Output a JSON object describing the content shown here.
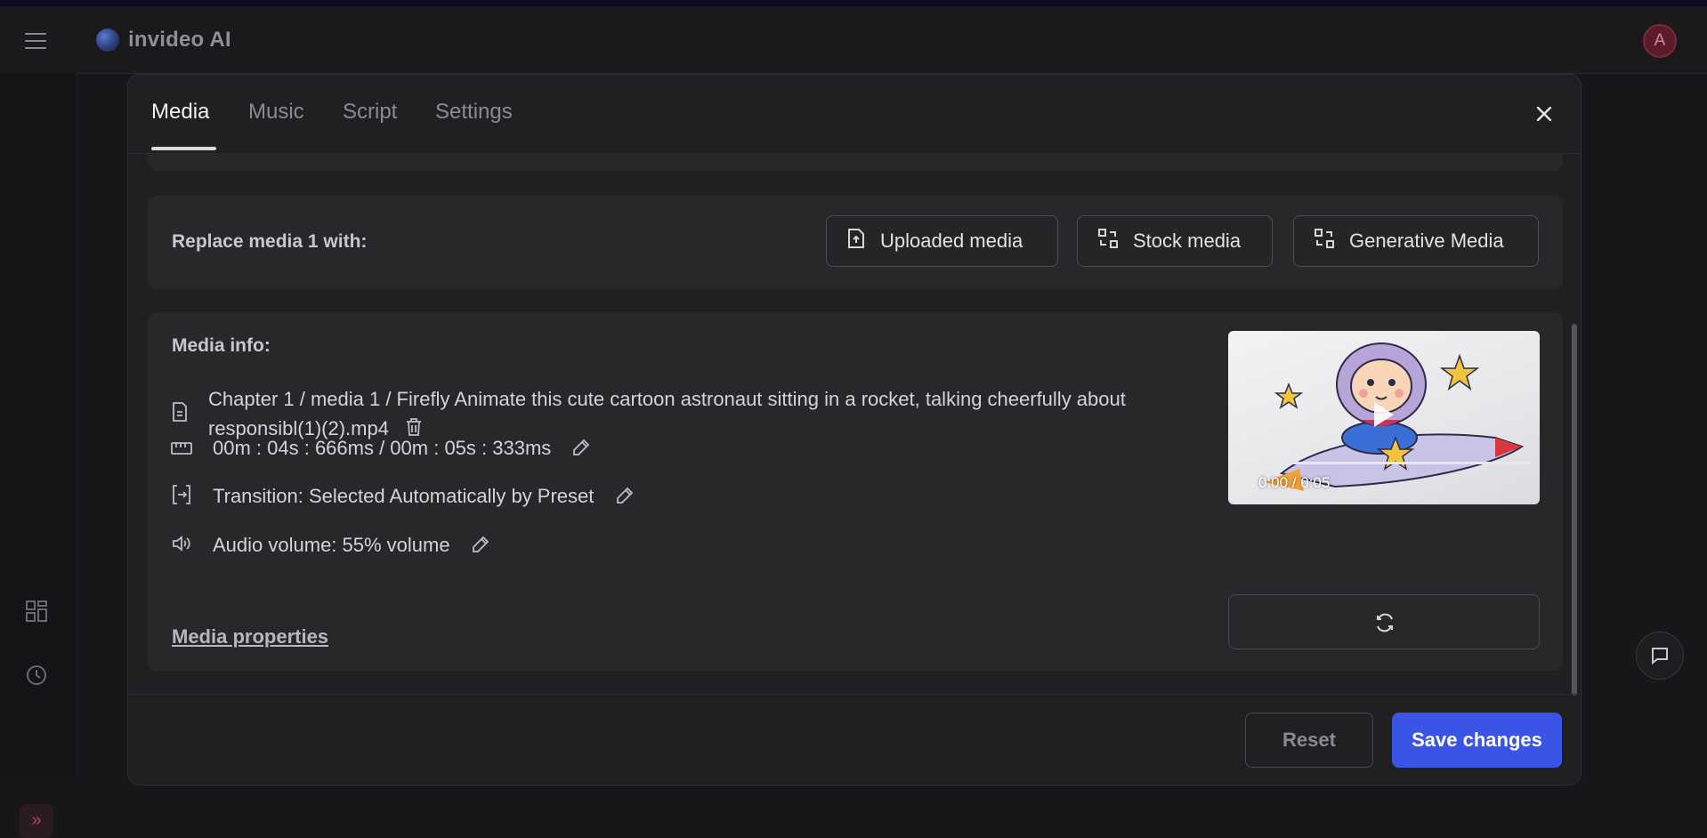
{
  "app": {
    "name": "invideo AI",
    "avatar_initial": "A"
  },
  "tabs": [
    {
      "label": "Media",
      "active": true
    },
    {
      "label": "Music",
      "active": false
    },
    {
      "label": "Script",
      "active": false
    },
    {
      "label": "Settings",
      "active": false
    }
  ],
  "replace": {
    "label": "Replace media 1 with:",
    "buttons": [
      "Uploaded media",
      "Stock media",
      "Generative Media"
    ]
  },
  "media_info": {
    "title": "Media info:",
    "file_line1": "Chapter 1 / media 1 / Firefly Animate this cute cartoon astronaut sitting in a rocket, talking cheerfully about",
    "file_line2": "responsibl(1)(2).mp4",
    "duration": "00m : 04s : 666ms / 00m : 05s : 333ms",
    "transition": "Transition: Selected Automatically by Preset",
    "volume": "Audio volume: 55% volume",
    "properties_link": "Media properties"
  },
  "video": {
    "time": "0:00 / 0:05"
  },
  "footer": {
    "reset": "Reset",
    "save": "Save changes"
  },
  "icons": [
    "menu-icon",
    "grid-icon",
    "history-icon",
    "chevrons-right-icon",
    "close-icon",
    "upload-file-icon",
    "swap-icon",
    "document-icon",
    "trash-icon",
    "ruler-icon",
    "transition-icon",
    "volume-icon",
    "pencil-icon",
    "refresh-icon",
    "chat-icon",
    "play-icon"
  ],
  "colors": {
    "accent": "#3a55e6",
    "background": "#17171a",
    "modal": "#202022",
    "card": "#28282b"
  }
}
